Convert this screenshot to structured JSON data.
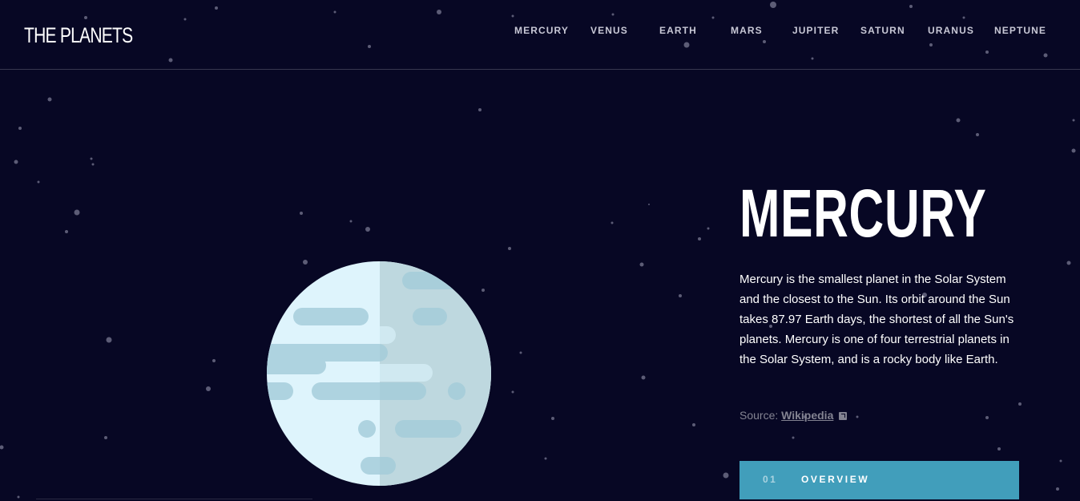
{
  "header": {
    "logo": "THE PLANETS",
    "nav": [
      "MERCURY",
      "VENUS",
      "EARTH",
      "MARS",
      "JUPITER",
      "SATURN",
      "URANUS",
      "NEPTUNE"
    ]
  },
  "planet": {
    "name": "MERCURY",
    "description": "Mercury is the smallest planet in the Solar System and the closest to the Sun. Its orbit around the Sun takes 87.97 Earth days, the shortest of all the Sun's planets. Mercury is one of four terrestrial planets in the Solar System, and is a rocky body like Earth.",
    "source_label": "Source:",
    "source_link": "Wikipedia",
    "source_icon": "external-link-icon"
  },
  "tabs": [
    {
      "number": "01",
      "label": "OVERVIEW",
      "active": true
    }
  ],
  "colors": {
    "background": "#070724",
    "accent": "#419ebb",
    "divider": "#38384f",
    "muted_text": "#838391",
    "planet_light": "#def4fc",
    "planet_shade": "#c9e0e6",
    "planet_craters": "#aed3e0"
  }
}
